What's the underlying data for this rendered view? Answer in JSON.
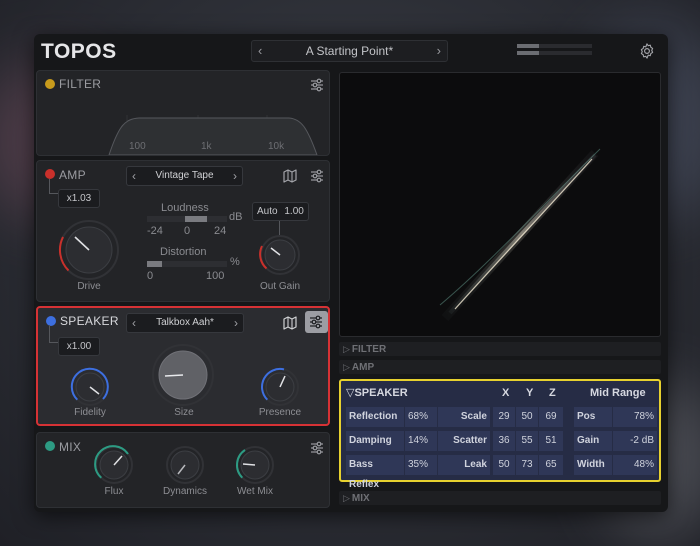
{
  "app": {
    "title": "TOPOS"
  },
  "preset": {
    "name": "A Starting Point*",
    "prev": "‹",
    "next": "›"
  },
  "meters": {
    "left_level": 0.3,
    "right_level": 0.3
  },
  "colors": {
    "filter_dot": "#c89b1c",
    "amp_dot": "#c9302b",
    "speaker_dot": "#3d6fe0",
    "mix_dot": "#2d9b83",
    "highlight_red": "#d63235",
    "highlight_yellow": "#e7d12f"
  },
  "filter": {
    "title": "FILTER",
    "ticks": [
      "100",
      "1k",
      "10k"
    ]
  },
  "amp": {
    "title": "AMP",
    "selector": {
      "value": "Vintage Tape",
      "prev": "‹",
      "next": "›"
    },
    "multiplier": "x1.03",
    "loudness": {
      "label": "Loudness",
      "unit": "dB",
      "min": "-24",
      "mid": "0",
      "max": "24",
      "level": 0.35
    },
    "distortion": {
      "label": "Distortion",
      "unit": "%",
      "min": "0",
      "max": "100",
      "level": 0.18
    },
    "auto": {
      "label": "Auto",
      "value": "1.00"
    },
    "knobs": {
      "drive": "Drive",
      "out_gain": "Out Gain"
    }
  },
  "speaker": {
    "title": "SPEAKER",
    "selector": {
      "value": "Talkbox Aah*",
      "prev": "‹",
      "next": "›"
    },
    "multiplier": "x1.00",
    "knobs": {
      "fidelity": "Fidelity",
      "size": "Size",
      "presence": "Presence"
    }
  },
  "mix": {
    "title": "MIX",
    "knobs": {
      "flux": "Flux",
      "dynamics": "Dynamics",
      "wet_mix": "Wet Mix"
    }
  },
  "right": {
    "collapsed": {
      "filter": "FILTER",
      "amp": "AMP",
      "mix": "MIX"
    },
    "speaker_table": {
      "title": "SPEAKER",
      "headers": {
        "x": "X",
        "y": "Y",
        "z": "Z",
        "mid_range": "Mid Range"
      },
      "rows": [
        {
          "label": "Reflection",
          "value": "68%",
          "param": "Scale",
          "x": "29",
          "y": "50",
          "z": "69",
          "mid_label": "Pos",
          "mid_value": "78%"
        },
        {
          "label": "Damping",
          "value": "14%",
          "param": "Scatter",
          "x": "36",
          "y": "55",
          "z": "51",
          "mid_label": "Gain",
          "mid_value": "-2 dB"
        },
        {
          "label": "Bass Reflex",
          "value": "35%",
          "param": "Leak",
          "x": "50",
          "y": "73",
          "z": "65",
          "mid_label": "Width",
          "mid_value": "48%"
        }
      ]
    }
  }
}
